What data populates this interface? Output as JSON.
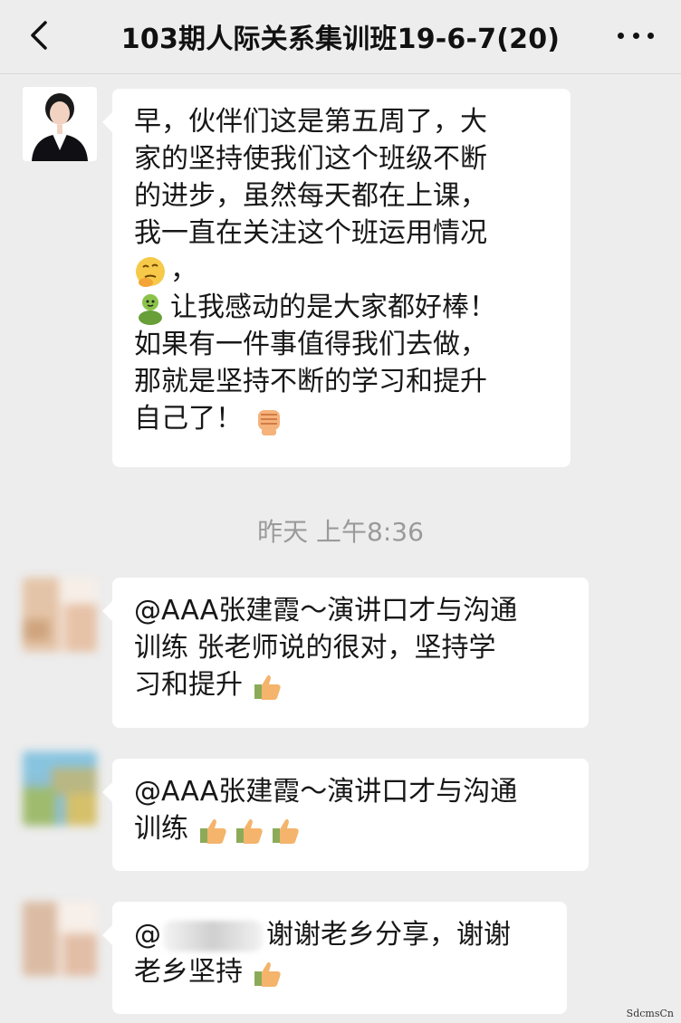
{
  "header": {
    "title": "103期人际关系集训班19-6-7(20)",
    "back_icon": "chevron-left-icon",
    "more_icon": "more-dots-icon"
  },
  "messages": [
    {
      "type": "text",
      "avatar_icon": "woman-in-suit-avatar",
      "lines": [
        "早，伙伴们这是第五周了，大",
        "家的坚持使我们这个班级不断",
        "的进步，虽然每天都在上课，",
        "我一直在关注这个班运用情况",
        "，",
        "让我感动的是大家都好棒！",
        "如果有一件事值得我们去做，",
        "那就是坚持不断的学习和提升",
        "自己了！"
      ],
      "emojis": [
        "thinking-face-icon",
        "green-person-icon",
        "raised-fist-icon"
      ]
    },
    {
      "type": "timestamp",
      "text": "昨天 上午8:36"
    },
    {
      "type": "text",
      "avatar_icon": "blurred-face-avatar",
      "lines": [
        "@AAA张建霞～演讲口才与沟通",
        "训练 张老师说的很对，坚持学",
        "习和提升"
      ],
      "emojis": [
        "thumbs-up-icon"
      ]
    },
    {
      "type": "text",
      "avatar_icon": "blurred-landscape-avatar",
      "lines": [
        "@AAA张建霞～演讲口才与沟通",
        "训练"
      ],
      "emojis": [
        "thumbs-up-icon",
        "thumbs-up-icon",
        "thumbs-up-icon"
      ]
    },
    {
      "type": "text",
      "avatar_icon": "blurred-face-avatar",
      "lines": [
        "@",
        "谢谢老乡分享，谢谢",
        "老乡坚持"
      ],
      "emojis": [
        "thumbs-up-icon"
      ]
    }
  ],
  "watermark": "SdcmsCn"
}
